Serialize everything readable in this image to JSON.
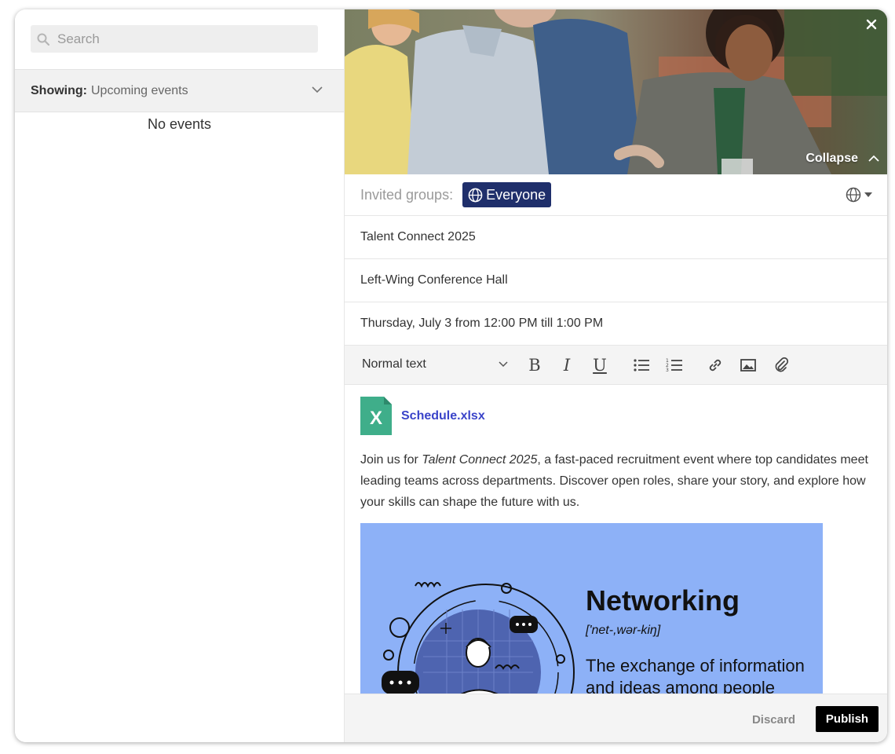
{
  "search": {
    "placeholder": "Search"
  },
  "filter": {
    "label": "Showing:",
    "value": "Upcoming events"
  },
  "event_list": {
    "empty_text": "No events"
  },
  "hero": {
    "collapse_label": "Collapse"
  },
  "invited": {
    "label": "Invited groups:",
    "group": "Everyone"
  },
  "event": {
    "title": "Talent Connect 2025",
    "location": "Left-Wing Conference Hall",
    "datetime": "Thursday, July 3 from 12:00 PM till 1:00 PM"
  },
  "toolbar": {
    "text_style": "Normal text",
    "buttons": [
      "bold",
      "italic",
      "underline",
      "bulleted-list",
      "numbered-list",
      "link",
      "image",
      "attachment"
    ]
  },
  "body": {
    "attachment_name": "Schedule.xlsx",
    "desc_pre": "Join us for ",
    "desc_em": "Talent Connect 2025",
    "desc_post": ", a fast-paced recruitment event where top candidates meet leading teams across departments. Discover open roles, share your story, and explore how your skills can shape the future with us."
  },
  "banner": {
    "title": "Networking",
    "phonetic": "['net-,wər-kiŋ]",
    "definition": "The exchange of information and ideas among people"
  },
  "footer": {
    "discard_label": "Discard",
    "publish_label": "Publish"
  },
  "colors": {
    "chip_bg": "#1f2f6b",
    "link": "#3a44c9",
    "banner_bg": "#8db1f7",
    "excel_green": "#3fae8a"
  }
}
